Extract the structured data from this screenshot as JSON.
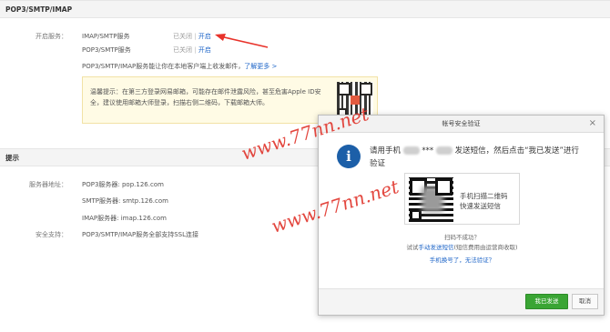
{
  "section1": {
    "title": "POP3/SMTP/IMAP"
  },
  "service": {
    "label": "开启服务：",
    "items": [
      {
        "name": "IMAP/SMTP服务",
        "status": "已关闭",
        "sep": "|",
        "action": "开启"
      },
      {
        "name": "POP3/SMTP服务",
        "status": "已关闭",
        "sep": "|",
        "action": "开启"
      }
    ],
    "desc": "POP3/SMTP/IMAP服务能让你在本地客户端上收发邮件，",
    "learn_more": "了解更多 >"
  },
  "tip": {
    "line1": "温馨提示：在第三方登录网易邮箱，可能存在邮件泄露风险，甚至危害Apple ID安",
    "line2": "全，建议使用邮箱大师登录，扫描右侧二维码，下载邮箱大师。"
  },
  "section2": {
    "title": "提示"
  },
  "servers": {
    "address_label": "服务器地址：",
    "pop3": "POP3服务器: pop.126.com",
    "smtp": "SMTP服务器: smtp.126.com",
    "imap": "IMAP服务器: imap.126.com",
    "ssl_label": "安全支持：",
    "ssl": "POP3/SMTP/IMAP服务全部支持SSL连接"
  },
  "watermark": "www.77nn.net",
  "dialog": {
    "title": "帐号安全验证",
    "close": "×",
    "msg_part1": "请用手机",
    "msg_masked": "***",
    "msg_part2": "发送短信，然后点击“我已发送”进行",
    "msg_line2": "验证",
    "qr_line1": "手机扫描二维码",
    "qr_line2": "快速发送短信",
    "scan_fail": "扫码不成功？",
    "try_prefix": "试试",
    "try_link": "手动发送短信",
    "try_suffix": "(短信费用由运营商收取)",
    "phone_changed": "手机换号了，无法验证？",
    "btn_sent": "我已发送",
    "btn_cancel": "取消"
  },
  "colors": {
    "link": "#1f66c8",
    "primary_button": "#3aa534",
    "watermark": "#e0342b",
    "arrow": "#e8322a",
    "info_icon": "#1c5fa8"
  }
}
